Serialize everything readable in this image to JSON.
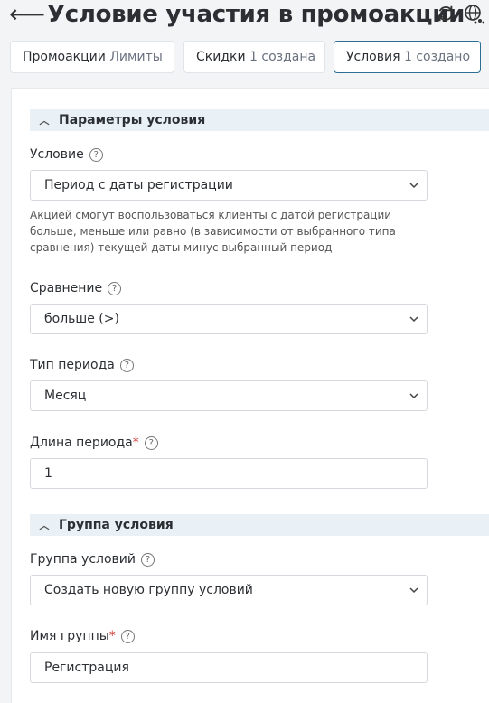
{
  "header": {
    "title": "Условие участия в промоакции",
    "back_icon": "arrow-left-icon",
    "refresh_icon": "refresh-icon",
    "globe_icon": "globe-network-icon"
  },
  "tabs": [
    {
      "label": "Промоакции",
      "count": "Лимиты",
      "active": false
    },
    {
      "label": "Скидки",
      "count": "1 создана",
      "active": false
    },
    {
      "label": "Условия",
      "count": "1 создано",
      "active": true
    }
  ],
  "sections": {
    "params": {
      "title": "Параметры условия"
    },
    "group": {
      "title": "Группа условия"
    }
  },
  "fields": {
    "condition": {
      "label": "Условие",
      "value": "Период с даты регистрации",
      "hint": "Акцией смогут воспользоваться клиенты с датой регистрации больше, меньше или равно (в зависимости от выбранного типа сравнения) текущей даты минус выбранный период"
    },
    "comparison": {
      "label": "Сравнение",
      "value": "больше (>)"
    },
    "period_type": {
      "label": "Тип периода",
      "value": "Месяц"
    },
    "period_length": {
      "label": "Длина периода",
      "required": "*",
      "value": "1"
    },
    "condition_group": {
      "label": "Группа условий",
      "value": "Создать новую группу условий"
    },
    "group_name": {
      "label": "Имя группы",
      "required": "*",
      "value": "Регистрация"
    }
  },
  "colors": {
    "accent": "#2c6f92",
    "section_bg": "#e9f0f6",
    "required": "#d0312d"
  }
}
